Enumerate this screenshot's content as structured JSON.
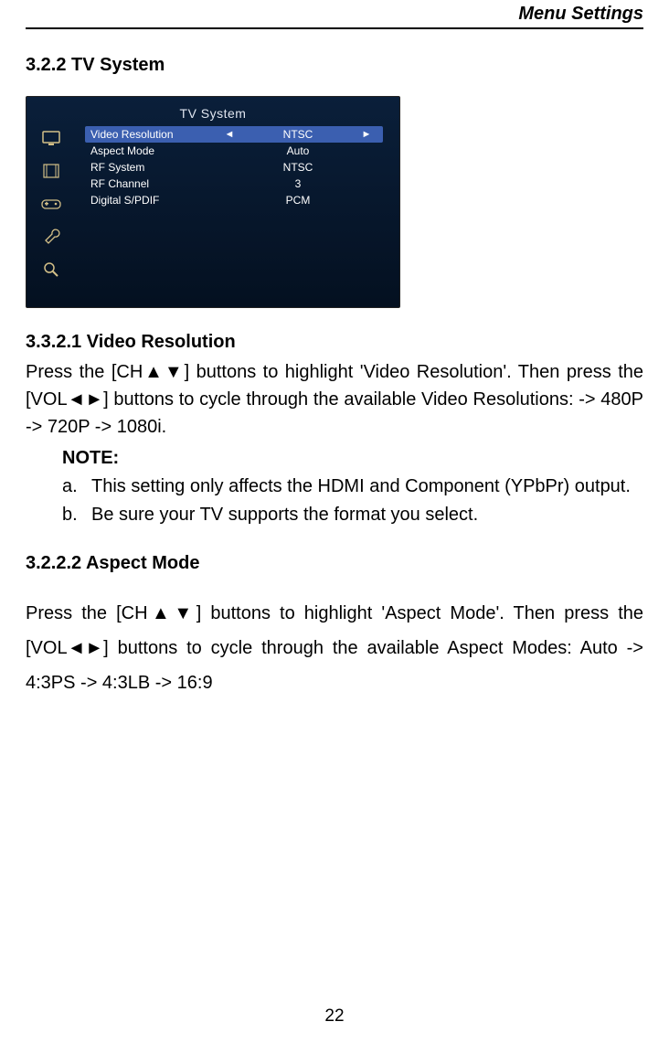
{
  "header": "Menu  Settings",
  "section_heading": "3.2.2    TV  System",
  "tv_screenshot": {
    "title": "TV System",
    "sidebar_icons": [
      "tv-icon",
      "film-icon",
      "gamepad-icon",
      "wrench-icon",
      "magnifier-icon"
    ],
    "rows": [
      {
        "label": "Video Resolution",
        "value": "NTSC",
        "selected": true
      },
      {
        "label": "Aspect Mode",
        "value": "Auto",
        "selected": false
      },
      {
        "label": "RF System",
        "value": "NTSC",
        "selected": false
      },
      {
        "label": "RF Channel",
        "value": "3",
        "selected": false
      },
      {
        "label": "Digital S/PDIF",
        "value": "PCM",
        "selected": false
      }
    ],
    "arrow_left": "◄",
    "arrow_right": "►"
  },
  "sec1_heading": "3.3.2.1    Video Resolution",
  "sec1_para": "Press  the  [CH▲▼]  buttons  to  highlight  'Video  Resolution'.    Then  press  the [VOL◄►] buttons to cycle through the available Video Resolutions: -> 480P -> 720P -> 1080i.",
  "note_label": "NOTE:",
  "note_a_letter": "a.",
  "note_a": "This setting only affects the HDMI and Component (YPbPr) output.",
  "note_b_letter": "b.",
  "note_b": "Be sure your TV supports the format you select.",
  "sec2_heading": "3.2.2.2      Aspect Mode",
  "sec2_para": "Press  the  [CH▲▼]  buttons  to  highlight  'Aspect  Mode'.    Then  press  the [VOL◄►] buttons to cycle through the available Aspect Modes: Auto -> 4:3PS -> 4:3LB -> 16:9",
  "page_number": "22"
}
